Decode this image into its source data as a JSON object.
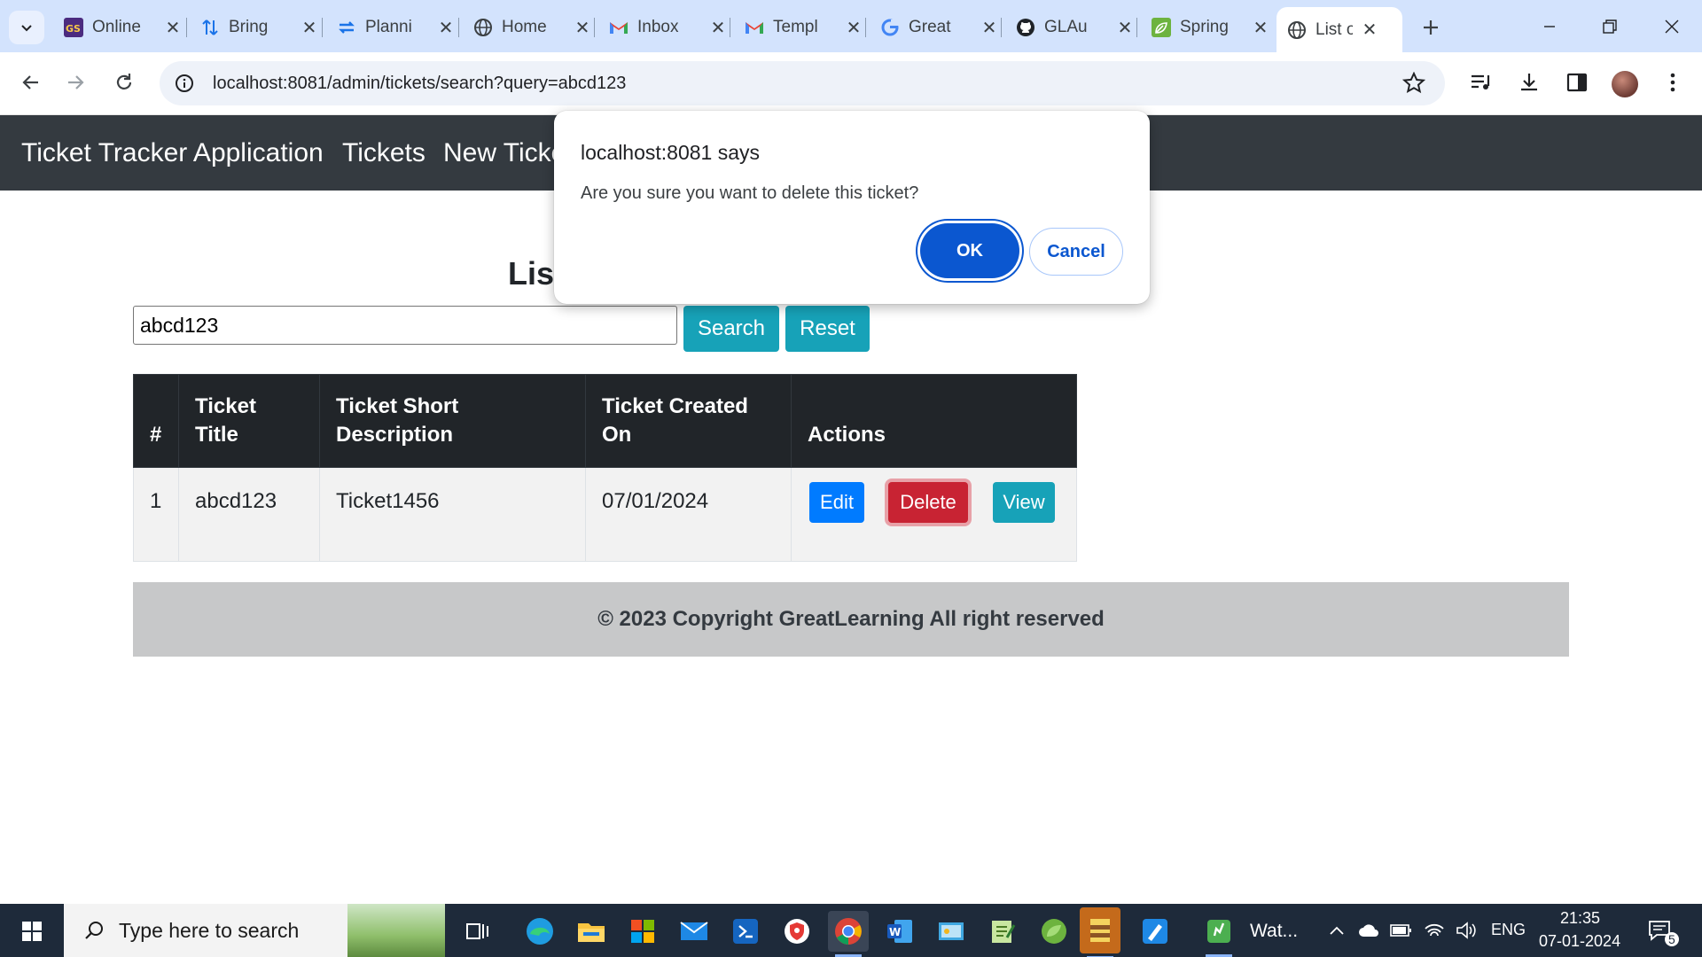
{
  "browser": {
    "tabs": [
      {
        "title": "Online",
        "icon": "gs-icon"
      },
      {
        "title": "Bring",
        "icon": "sort-arrows-icon"
      },
      {
        "title": "Planni",
        "icon": "sync-arrows-icon"
      },
      {
        "title": "Home",
        "icon": "globe-icon"
      },
      {
        "title": "Inbox",
        "icon": "gmail-icon"
      },
      {
        "title": "Templ",
        "icon": "gmail-icon"
      },
      {
        "title": "Great",
        "icon": "google-icon"
      },
      {
        "title": "GLAu",
        "icon": "github-icon"
      },
      {
        "title": "Spring",
        "icon": "leaf-icon"
      },
      {
        "title": "List of",
        "icon": "globe-icon",
        "active": true
      }
    ],
    "url": "localhost:8081/admin/tickets/search?query=abcd123",
    "accent": "#d3e3fd"
  },
  "navbar": {
    "brand": "Ticket Tracker Application",
    "links": [
      "Tickets",
      "New Ticket"
    ]
  },
  "page": {
    "heading": "List",
    "search_value": "abcd123",
    "search_button": "Search",
    "reset_button": "Reset",
    "table": {
      "headers": [
        "#",
        "Ticket Title",
        "Ticket Short Description",
        "Ticket Created On",
        "Actions"
      ],
      "rows": [
        {
          "num": "1",
          "title": "abcd123",
          "description": "Ticket1456",
          "created_on": "07/01/2024"
        }
      ],
      "actions": {
        "edit": "Edit",
        "delete": "Delete",
        "view": "View"
      }
    },
    "footer": "© 2023 Copyright GreatLearning All right reserved"
  },
  "dialog": {
    "title": "localhost:8081 says",
    "message": "Are you sure you want to delete this ticket?",
    "ok": "OK",
    "cancel": "Cancel"
  },
  "taskbar": {
    "search_placeholder": "Type here to search",
    "running_app_label": "Wat...",
    "language": "ENG",
    "time": "21:35",
    "date": "07-01-2024",
    "notification_count": "5"
  },
  "colors": {
    "navbar": "#343a40",
    "info": "#17a2b8",
    "primary": "#007bff",
    "danger": "#c82333",
    "dialog_ok": "#0b57d0"
  }
}
